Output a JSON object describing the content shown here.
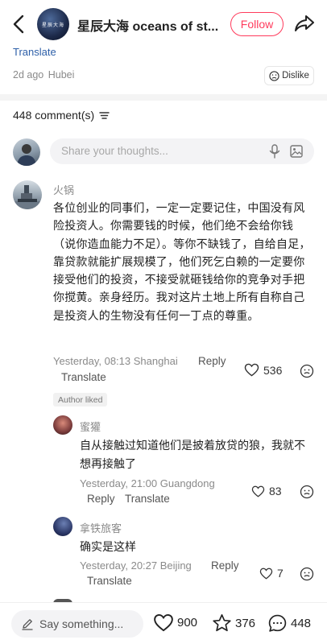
{
  "header": {
    "channel_name": "星辰大海 oceans of st...",
    "avatar_text": "星辰大海",
    "follow_label": "Follow"
  },
  "post": {
    "translate_label": "Translate",
    "time": "2d ago",
    "location": "Hubei",
    "dislike_label": "Dislike"
  },
  "comments_header": {
    "count_label": "448 comment(s)"
  },
  "composer": {
    "placeholder": "Share your thoughts..."
  },
  "comments": [
    {
      "name": "火锅",
      "text": "各位创业的同事们，一定一定要记住，中国没有风险投资人。你需要钱的时候，他们绝不会给你钱（说你造血能力不足）。等你不缺钱了，自给自足，靠贷款就能扩展规模了，他们死乞白赖的一定要你接受他们的投资，不接受就砸钱给你的竞争对手把你搅黄。亲身经历。我对这片土地上所有自称自己是投资人的生物没有任何一丁点的尊重。",
      "time": "Yesterday, 08:13",
      "location": "Shanghai",
      "reply_label": "Reply",
      "translate_label": "Translate",
      "likes": "536",
      "badge": "Author liked",
      "replies": [
        {
          "name": "蜜獾",
          "text": "自从接触过知道他们是披着放贷的狼，我就不想再接触了",
          "time": "Yesterday, 21:00",
          "location": "Guangdong",
          "reply_label": "Reply",
          "translate_label": "Translate",
          "likes": "83"
        },
        {
          "name": "拿铁旅客",
          "text": "确实是这样",
          "time": "Yesterday, 20:27",
          "location": "Beijing",
          "reply_label": "Reply",
          "translate_label": "Translate",
          "likes": "7"
        }
      ]
    }
  ],
  "bottom_bar": {
    "say_placeholder": "Say something...",
    "likes": "900",
    "favorites": "376",
    "comments": "448"
  },
  "colors": {
    "accent": "#ff3b5c",
    "link": "#2d5fa8"
  }
}
